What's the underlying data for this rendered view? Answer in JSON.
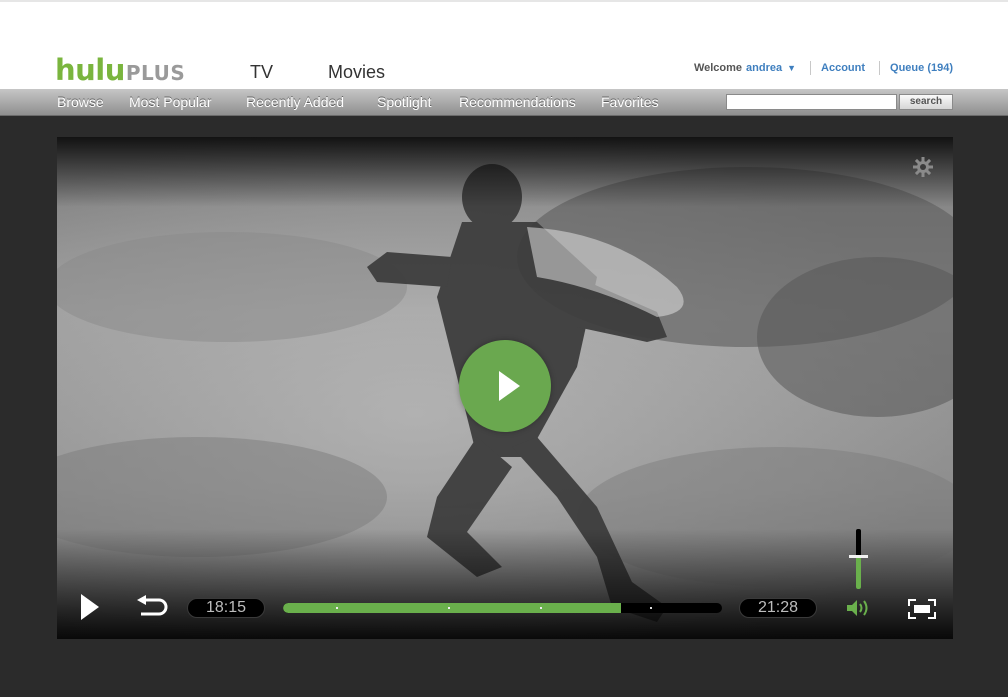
{
  "header": {
    "logo_main": "hulu",
    "logo_sub": "PLUS",
    "nav": {
      "tv": "TV",
      "movies": "Movies"
    },
    "welcome_label": "Welcome",
    "username": "andrea",
    "account_link": "Account",
    "queue_link": "Queue (194)"
  },
  "subnav": {
    "items": [
      "Browse",
      "Most Popular",
      "Recently Added",
      "Spotlight",
      "Recommendations",
      "Favorites"
    ],
    "search_placeholder": "",
    "search_button": "search"
  },
  "player": {
    "elapsed_time": "18:15",
    "remaining_time": "21:28",
    "progress_fraction": 0.77,
    "chapter_marker_fractions": [
      0.12,
      0.375,
      0.585,
      0.835
    ],
    "volume_fraction": 0.55,
    "icons": {
      "settings": "gear-icon",
      "big_play": "play-icon",
      "play": "play-icon",
      "rewind": "rewind-icon",
      "volume": "volume-icon",
      "fullscreen": "fullscreen-icon"
    },
    "accent_color": "#6ab04c"
  }
}
